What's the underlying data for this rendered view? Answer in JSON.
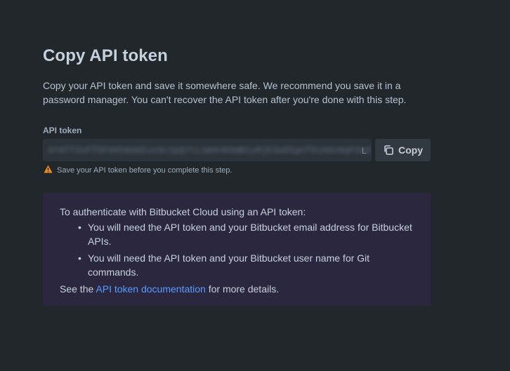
{
  "page": {
    "title": "Copy API token",
    "description": "Copy your API token and save it somewhere safe. We recommend you save it in a password manager. You can't recover the API token after you're done with this step."
  },
  "token_field": {
    "label": "API token",
    "value": "ATATT3xFfGF0Xh8aHZuv9c2pQ7tLsW4nK6mB1yRjE3oD5gVf8iA0zNqP2wXkYbCtUe9aLp",
    "tail": "L",
    "copy_label": "Copy",
    "copy_icon": "copy-icon"
  },
  "warning": {
    "icon": "warning-icon",
    "text": "Save your API token before you complete this step."
  },
  "info": {
    "intro": "To authenticate with Bitbucket Cloud using an API token:",
    "bullets": [
      "You will need the API token and your Bitbucket email address for Bitbucket APIs.",
      "You will need the API token and your Bitbucket user name for Git commands."
    ],
    "footer_prefix": "See the",
    "footer_link": "API token documentation",
    "footer_suffix": "for more details."
  },
  "colors": {
    "background": "#22272b",
    "panel": "#2b273f",
    "link": "#579dff",
    "warning": "#f5cd47"
  }
}
